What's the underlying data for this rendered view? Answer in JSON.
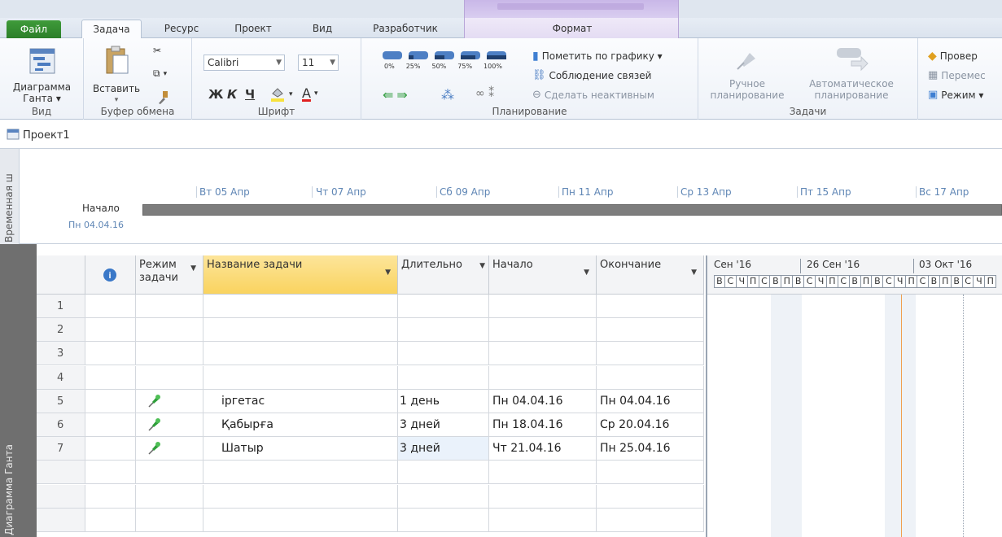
{
  "ribbon_tabs": {
    "file": "Файл",
    "task": "Задача",
    "resource": "Ресурс",
    "project": "Проект",
    "view": "Вид",
    "developer": "Разработчик",
    "format": "Формат"
  },
  "view_group": {
    "gantt_label_1": "Диаграмма",
    "gantt_label_2": "Ганта ▾",
    "group_label": "Вид"
  },
  "clipboard_group": {
    "paste_label": "Вставить",
    "group_label": "Буфер обмена"
  },
  "font_group": {
    "font_name": "Calibri",
    "font_size": "11",
    "bold": "Ж",
    "italic": "К",
    "underline": "Ч",
    "group_label": "Шрифт"
  },
  "schedule_group": {
    "pct_labels": [
      "0%",
      "25%",
      "50%",
      "75%",
      "100%"
    ],
    "mark_on_track": "Пометить по графику ▾",
    "respect_links": "Соблюдение связей",
    "inactivate": "Сделать неактивным",
    "group_label": "Планирование"
  },
  "tasks_group": {
    "manual_1": "Ручное",
    "manual_2": "планирование",
    "auto_1": "Автоматическое",
    "auto_2": "планирование",
    "group_label": "Задачи"
  },
  "right_group": {
    "inspect": "Провер",
    "move": "Перемес",
    "mode": "Режим ▾"
  },
  "project_name": "Проект1",
  "timeline": {
    "sidebar_label": "Временная ш",
    "dates": [
      "Вт 05 Апр",
      "Чт 07 Апр",
      "Сб 09 Апр",
      "Пн 11 Апр",
      "Ср 13 Апр",
      "Пт 15 Апр",
      "Вс 17 Апр"
    ],
    "start_label": "Начало",
    "start_date": "Пн 04.04.16"
  },
  "gantt_sidebar_label": "Диаграмма Ганта",
  "columns": {
    "info": "i",
    "mode_1": "Режим",
    "mode_2": "задачи",
    "name": "Название задачи",
    "duration": "Длительно",
    "start": "Начало",
    "finish": "Окончание"
  },
  "rows": [
    {
      "num": "1",
      "name": "",
      "duration": "",
      "start": "",
      "finish": ""
    },
    {
      "num": "2",
      "name": "",
      "duration": "",
      "start": "",
      "finish": ""
    },
    {
      "num": "3",
      "name": "",
      "duration": "",
      "start": "",
      "finish": ""
    },
    {
      "num": "4",
      "name": "",
      "duration": "",
      "start": "",
      "finish": ""
    },
    {
      "num": "5",
      "name": "іргетас",
      "duration": "1 день",
      "start": "Пн 04.04.16",
      "finish": "Пн 04.04.16"
    },
    {
      "num": "6",
      "name": "Қабырға",
      "duration": "3 дней",
      "start": "Пн 18.04.16",
      "finish": "Ср 20.04.16"
    },
    {
      "num": "7",
      "name": "Шатыр",
      "duration": "3 дней",
      "start": "Чт 21.04.16",
      "finish": "Пн 25.04.16"
    }
  ],
  "chart": {
    "weeks": [
      "Сен '16",
      "26 Сен '16",
      "03 Окт '16"
    ],
    "day_letters": [
      "В",
      "С",
      "Ч",
      "П",
      "С",
      "В",
      "П",
      "В",
      "С",
      "Ч",
      "П",
      "С",
      "В",
      "П",
      "В",
      "С",
      "Ч",
      "П",
      "С",
      "В",
      "П",
      "В",
      "С",
      "Ч",
      "П"
    ]
  }
}
